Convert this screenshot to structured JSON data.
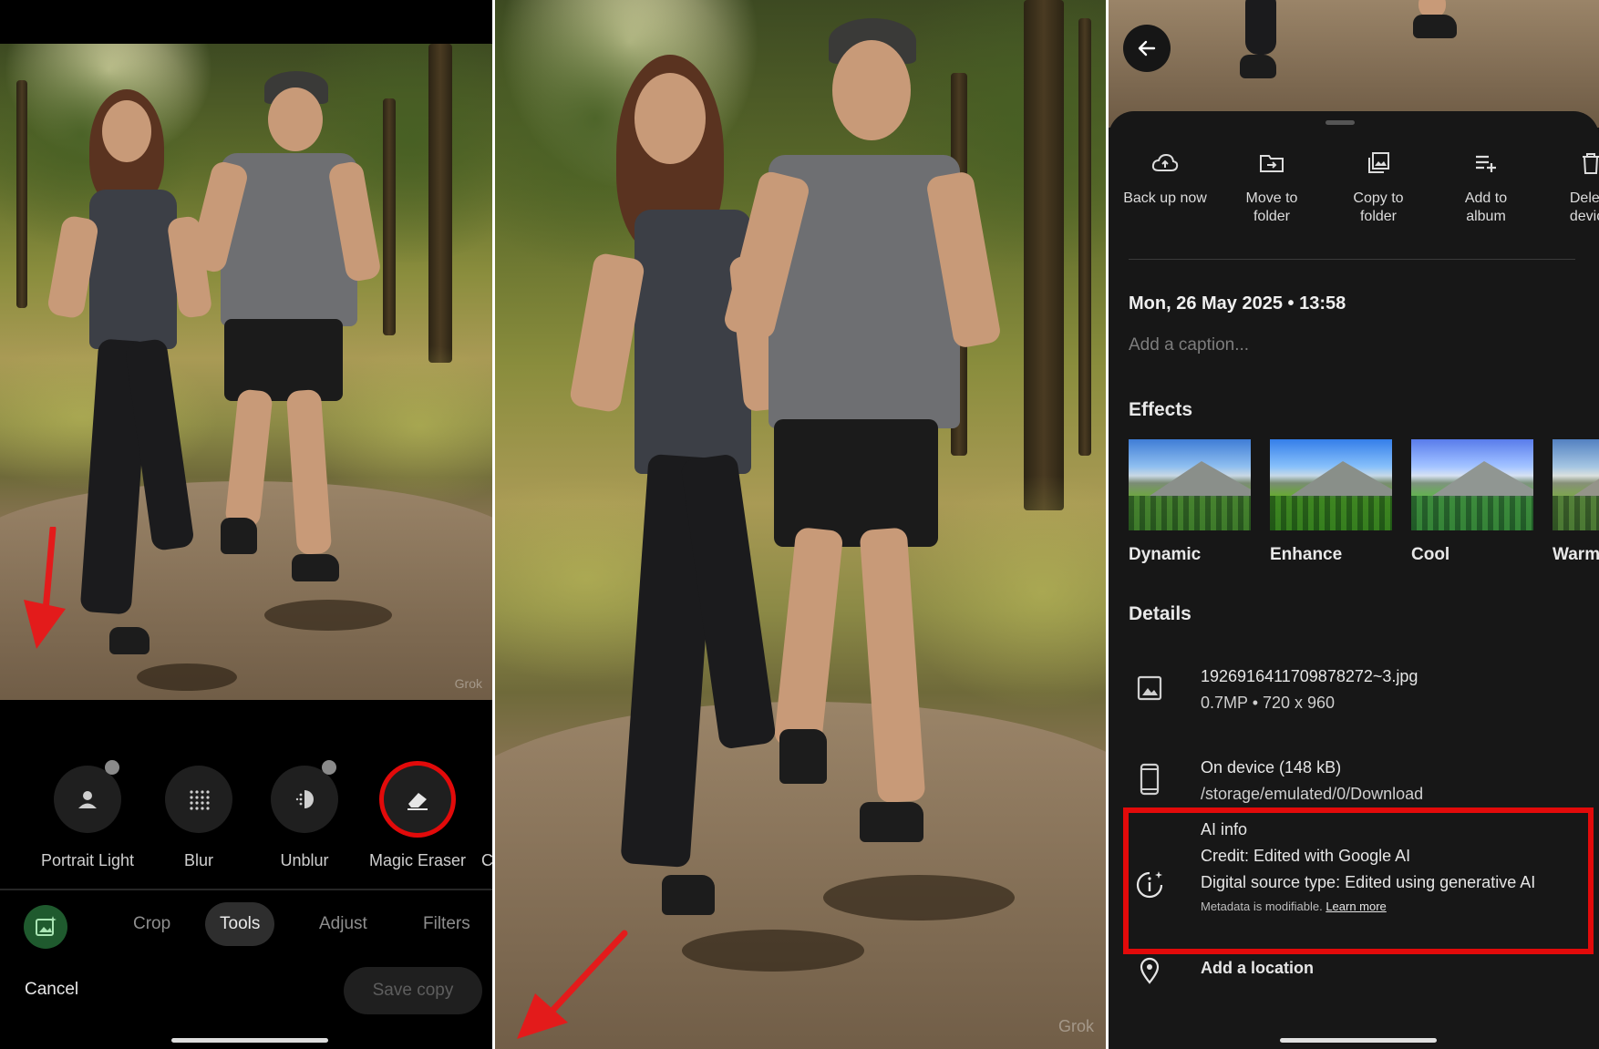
{
  "left_editor": {
    "tools": [
      {
        "label": "Portrait Light",
        "icon": "portrait-light-icon"
      },
      {
        "label": "Blur",
        "icon": "blur-icon"
      },
      {
        "label": "Unblur",
        "icon": "unblur-icon"
      },
      {
        "label": "Magic Eraser",
        "icon": "eraser-icon"
      },
      {
        "label": "C"
      }
    ],
    "tabs": [
      "Crop",
      "Tools",
      "Adjust",
      "Filters"
    ],
    "active_tab": "Tools",
    "cancel_label": "Cancel",
    "save_copy_label": "Save copy",
    "watermark": "Grok"
  },
  "middle_photo": {
    "watermark": "Grok"
  },
  "right_info": {
    "actions": [
      {
        "label": "Back up now",
        "icon": "cloud-upload-icon"
      },
      {
        "label": "Move to folder",
        "icon": "move-folder-icon"
      },
      {
        "label": "Copy to folder",
        "icon": "copy-folder-icon"
      },
      {
        "label": "Add to album",
        "icon": "add-playlist-icon"
      },
      {
        "label": "Delete device",
        "icon": "delete-icon"
      }
    ],
    "date_time": "Mon, 26 May 2025 • 13:58",
    "caption_placeholder": "Add a caption...",
    "effects_heading": "Effects",
    "effects": [
      "Dynamic",
      "Enhance",
      "Cool",
      "Warm"
    ],
    "details_heading": "Details",
    "file": {
      "name": "1926916411709878272~3.jpg",
      "meta": "0.7MP • 720 x 960"
    },
    "storage": {
      "title": "On device (148 kB)",
      "path": "/storage/emulated/0/Download"
    },
    "ai_info": {
      "title": "AI info",
      "credit": "Credit: Edited with Google AI",
      "source_type": "Digital source type: Edited using generative AI",
      "metadata_note": "Metadata is modifiable.",
      "learn_more": "Learn more"
    },
    "location_label": "Add a location"
  },
  "colors": {
    "highlight": "#e20a0a",
    "sheet_bg": "#171717",
    "editor_bg": "#000000"
  }
}
